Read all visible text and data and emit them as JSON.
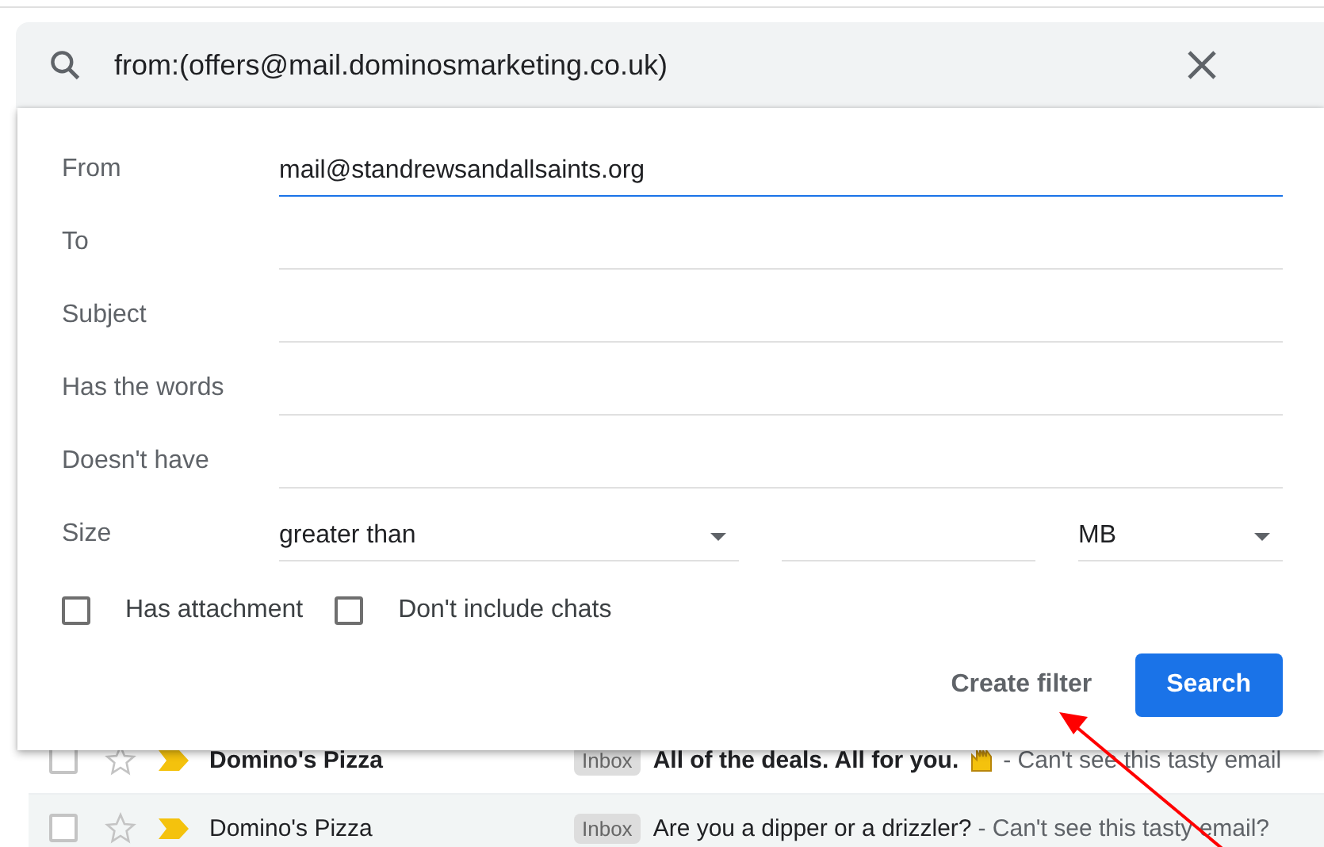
{
  "search": {
    "query": "from:(offers@mail.dominosmarketing.co.uk)"
  },
  "filter_form": {
    "fields": [
      {
        "label": "From",
        "value": "mail@standrewsandallsaints.org",
        "focused": true
      },
      {
        "label": "To",
        "focused": false
      },
      {
        "label": "Subject",
        "focused": false
      },
      {
        "label": "Has the words",
        "focused": false
      },
      {
        "label": "Doesn't have",
        "focused": false
      }
    ],
    "size": {
      "label": "Size",
      "comparison": "greater than",
      "unit": "MB"
    },
    "checkboxes": [
      {
        "label": "Has attachment",
        "checked": false
      },
      {
        "label": "Don't include chats",
        "checked": false
      }
    ],
    "buttons": [
      {
        "label": "Create filter",
        "kind": "text"
      },
      {
        "label": "Search",
        "kind": "primary"
      }
    ]
  },
  "emails": [
    {
      "sender": "Domino's Pizza",
      "tag": "Inbox",
      "subject": "All of the deals. All for you.",
      "snippet": "- Can't see this tasty email",
      "unread": true,
      "emoji": true
    },
    {
      "sender": "Domino's Pizza",
      "tag": "Inbox",
      "subject": "Are you a dipper or a drizzler?",
      "snippet": "- Can't see this tasty email?",
      "unread": false,
      "emoji": false
    }
  ]
}
